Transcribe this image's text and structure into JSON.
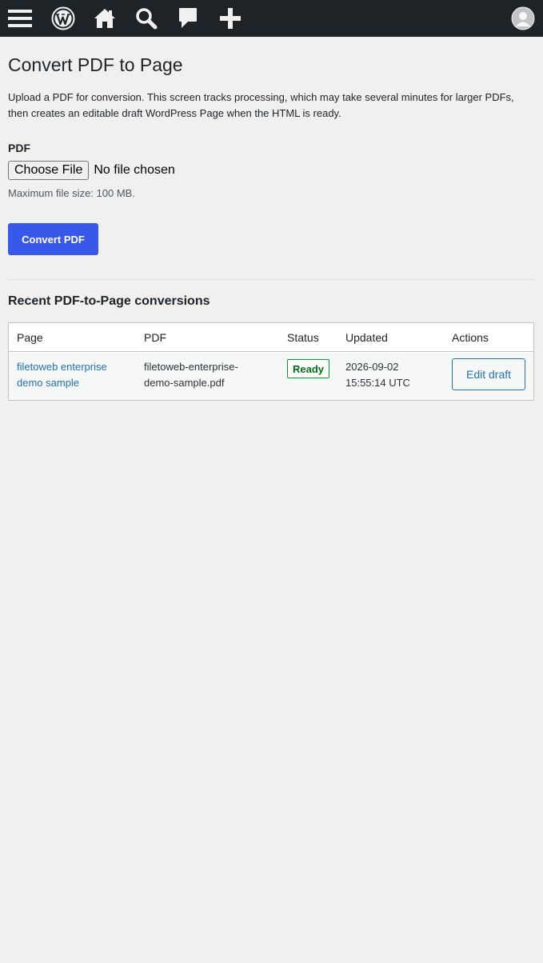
{
  "adminbar": {
    "items": [
      {
        "icon": "menu-icon"
      },
      {
        "icon": "wordpress-logo-icon"
      },
      {
        "icon": "home-icon"
      },
      {
        "icon": "search-icon"
      },
      {
        "icon": "comments-icon"
      },
      {
        "icon": "new-content-icon"
      }
    ],
    "avatar_icon": "avatar-icon"
  },
  "page": {
    "title": "Convert PDF to Page",
    "intro": "Upload a PDF for conversion. This screen tracks processing, which may take several minutes for larger PDFs, then creates an editable draft WordPress Page when the HTML is ready.",
    "pdf_label": "PDF",
    "choose_file": "Choose File",
    "no_file": "No file chosen",
    "max_size": "Maximum file size: 100 MB.",
    "convert_button": "Convert PDF"
  },
  "recent": {
    "heading": "Recent PDF-to-Page conversions",
    "columns": [
      "Page",
      "PDF",
      "Status",
      "Updated",
      "Actions"
    ],
    "rows": [
      {
        "page_line1": "filetoweb enterprise",
        "page_line2": "demo sample",
        "pdf_line1": "filetoweb-enterprise-",
        "pdf_line2": "demo-sample.pdf",
        "status": "Ready",
        "updated_line1": "2026-09-02",
        "updated_line2": "15:55:14 UTC",
        "action": "Edit draft"
      }
    ]
  },
  "colors": {
    "adminbar": "#1d2327",
    "background": "#f0f0f1",
    "primary": "#3858e9",
    "link": "#2271b1",
    "ready": "#00a32a"
  }
}
